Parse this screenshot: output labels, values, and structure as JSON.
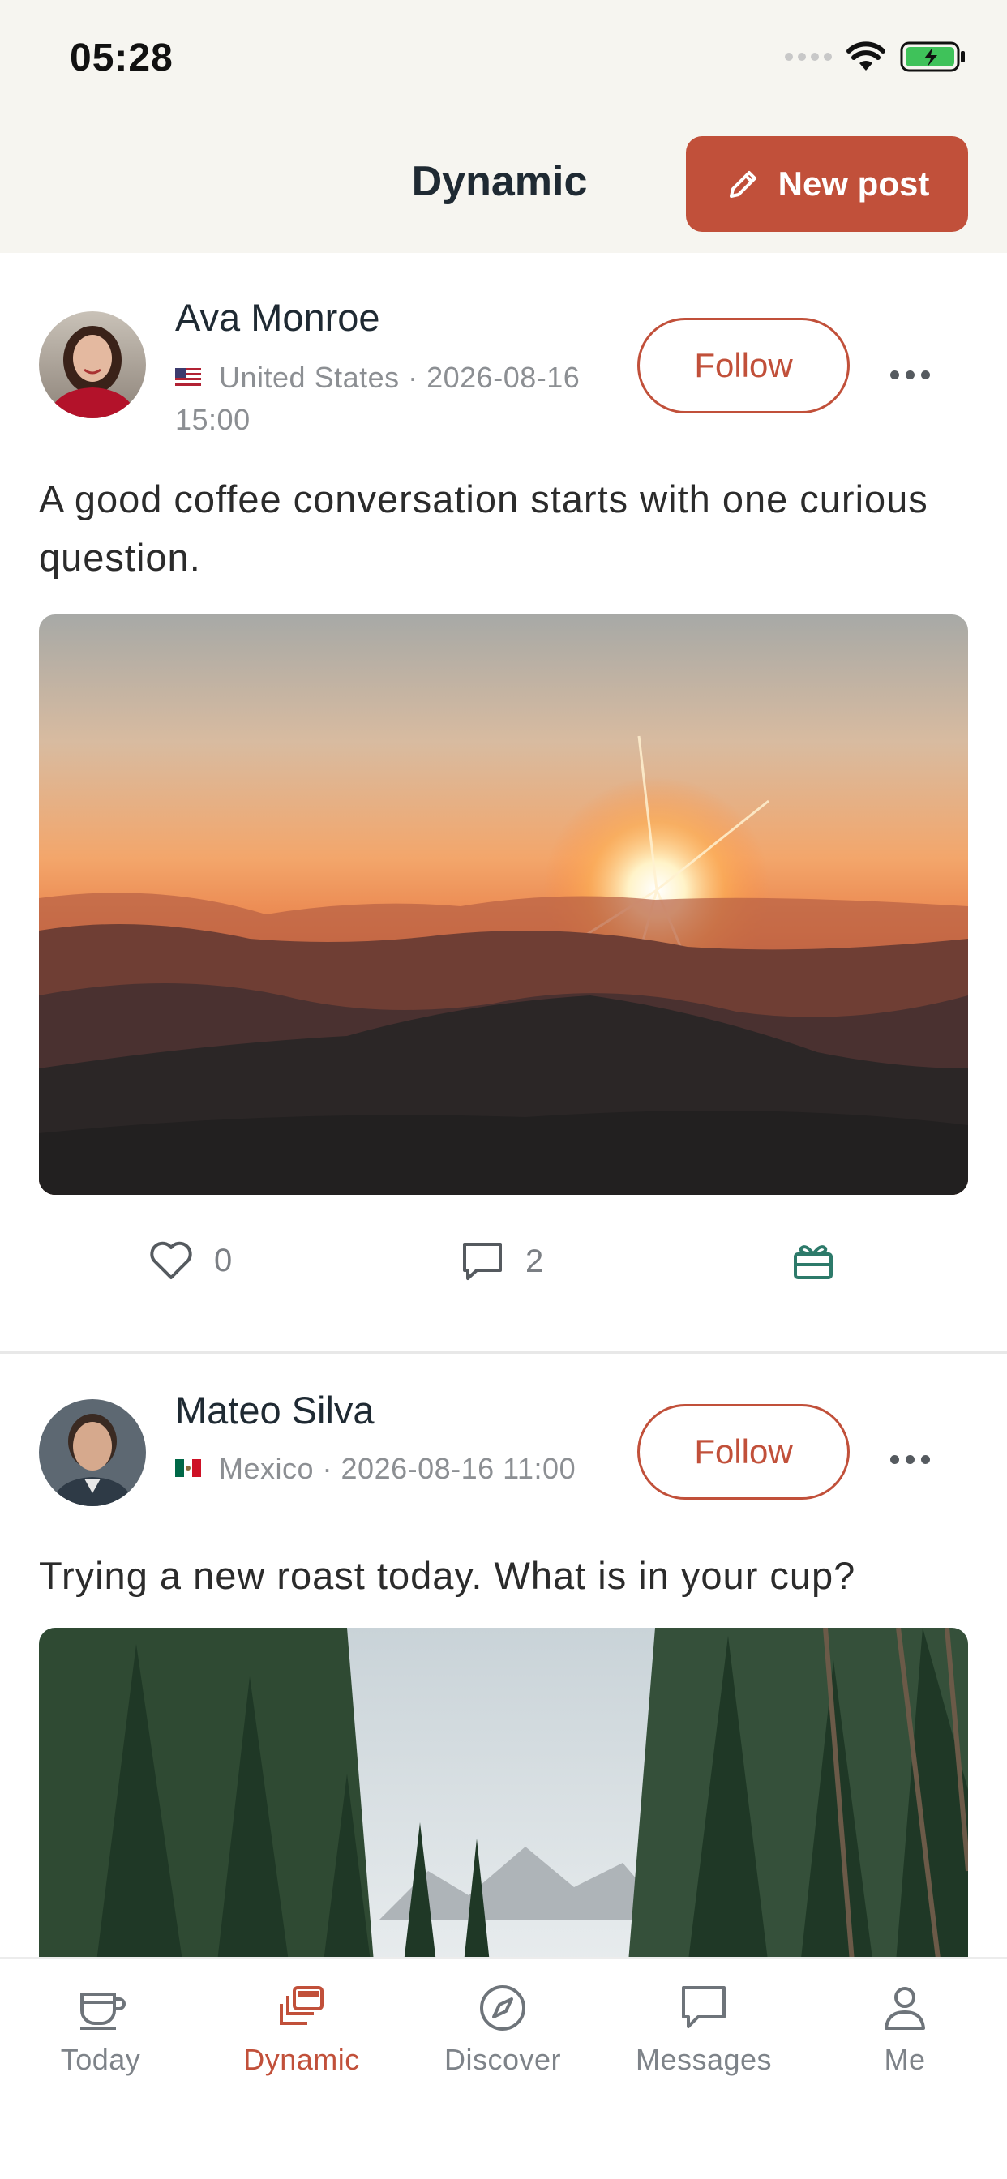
{
  "status_bar": {
    "time": "05:28"
  },
  "header": {
    "title": "Dynamic",
    "new_post_label": "New post"
  },
  "posts": [
    {
      "author": "Ava Monroe",
      "country": "United States",
      "meta_line1": "United States · 2026-08-16",
      "meta_line2": "15:00",
      "follow_label": "Follow",
      "text": "A good coffee conversation starts with one curious question.",
      "likes": "0",
      "comments": "2"
    },
    {
      "author": "Mateo Silva",
      "country": "Mexico",
      "meta_line1": "Mexico · 2026-08-16 11:00",
      "follow_label": "Follow",
      "text": "Trying a new roast today. What is in your cup?"
    }
  ],
  "tabs": [
    {
      "label": "Today",
      "icon": "cup-icon"
    },
    {
      "label": "Dynamic",
      "icon": "cards-icon",
      "active": true
    },
    {
      "label": "Discover",
      "icon": "compass-icon"
    },
    {
      "label": "Messages",
      "icon": "chat-icon"
    },
    {
      "label": "Me",
      "icon": "person-icon"
    }
  ],
  "colors": {
    "accent": "#c1503a",
    "gift": "#2d7a6a",
    "header_bg": "#f6f5f0"
  }
}
